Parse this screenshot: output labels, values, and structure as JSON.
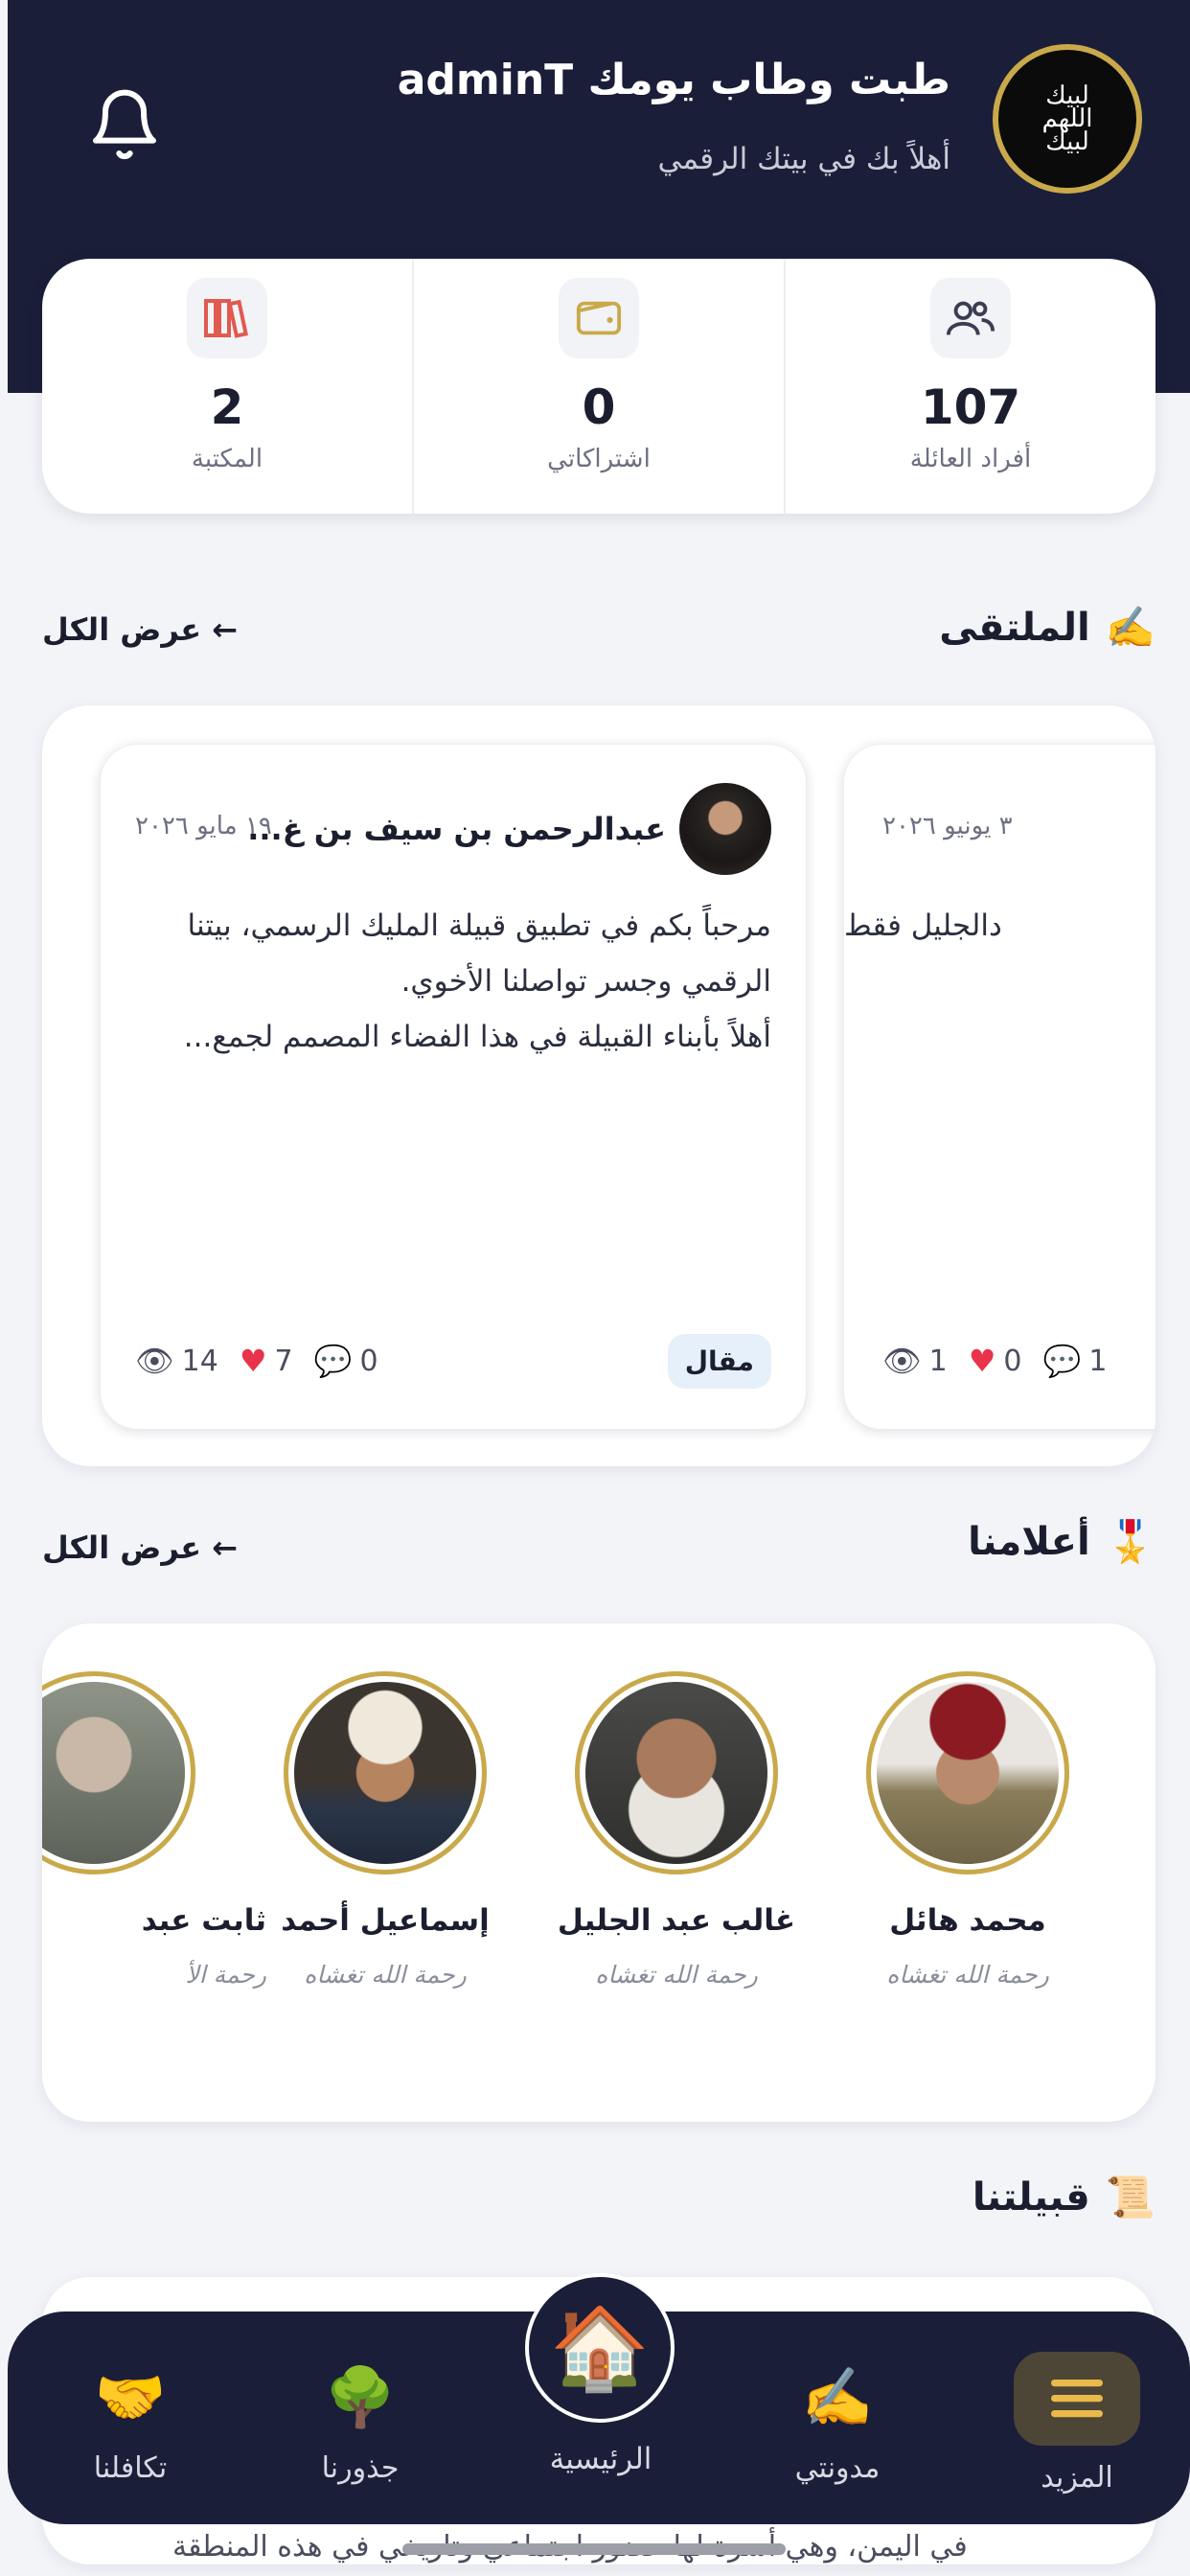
{
  "header": {
    "title": "طبت وطاب يومك adminT",
    "subtitle": "أهلاً بك في بيتك الرقمي",
    "logo_text": "لبيك اللهم لبيك"
  },
  "stats": [
    {
      "value": "107",
      "label": "أفراد العائلة",
      "icon": "users-icon"
    },
    {
      "value": "0",
      "label": "اشتراكاتي",
      "icon": "wallet-icon"
    },
    {
      "value": "2",
      "label": "المكتبة",
      "icon": "books-icon"
    }
  ],
  "forum": {
    "title": "الملتقى",
    "emoji": "✍️",
    "view_all": "عرض الكل ←",
    "posts": [
      {
        "author": "عبدالرحمن بن سيف بن غ...",
        "date": "١٩ مايو ٢٠٢٦",
        "body": "مرحباً بكم في تطبيق قبيلة المليك الرسمي، بيتنا الرقمي وجسر تواصلنا الأخوي.\nأهلاً بأبناء القبيلة في هذا الفضاء المصمم لجمع...",
        "tag": "مقال",
        "views": "14",
        "likes": "7",
        "comments": "0"
      },
      {
        "author": "",
        "date": "٣ يونيو ٢٠٢٦",
        "body": "دالجليل فقط",
        "views": "1",
        "likes": "0",
        "comments": "1"
      }
    ]
  },
  "notables": {
    "title": "أعلامنا",
    "emoji": "🎖️",
    "view_all": "عرض الكل ←",
    "people": [
      {
        "name": "محمد هائل",
        "desc": "رحمة الله تغشاه"
      },
      {
        "name": "غالب عبد الجليل",
        "desc": "رحمة الله تغشاه"
      },
      {
        "name": "إسماعيل أحمد",
        "desc": "رحمة الله تغشاه"
      },
      {
        "name": "ثابت عبد",
        "desc": "رحمة الأ"
      }
    ]
  },
  "tribe": {
    "title": "قبيلتنا",
    "emoji": "📜",
    "text": "في اليمن، وهي أسرة لها حضور اجتماعي وتاريخي في هذه المنطقة"
  },
  "nav": {
    "items": [
      {
        "label": "تكافلنا",
        "icon": "🤝"
      },
      {
        "label": "جذورنا",
        "icon": "🌳"
      },
      {
        "label": "الرئيسية",
        "icon": "🏠"
      },
      {
        "label": "مدونتي",
        "icon": "✍️"
      },
      {
        "label": "المزيد",
        "icon": "menu-icon"
      }
    ]
  },
  "colors": {
    "navy": "#1b1e38",
    "gold": "#c9a94a",
    "background": "#f3f4f8",
    "heart": "#e8334a"
  }
}
